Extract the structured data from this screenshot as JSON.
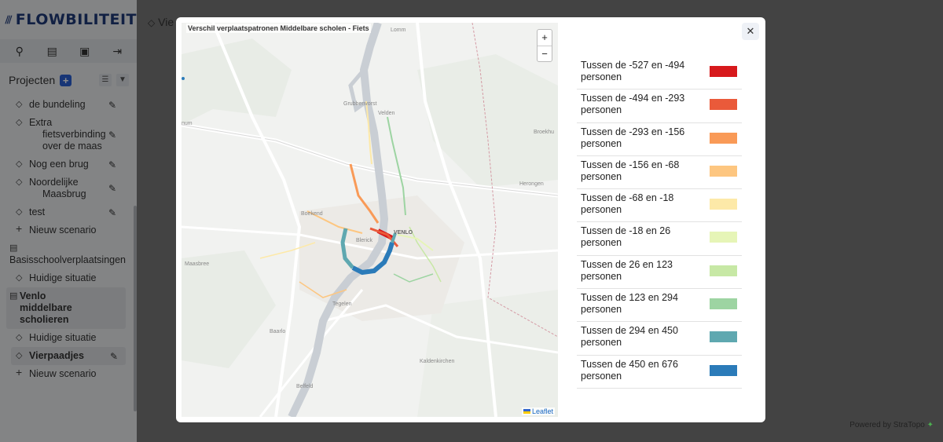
{
  "app": {
    "logo": "FLOWBILITEIT"
  },
  "sidebar": {
    "projects_title": "Projecten",
    "items": [
      {
        "label": "de bundeling",
        "level": 1,
        "edit": true
      },
      {
        "label": "Extra fietsverbinding over de maas",
        "level": 1,
        "edit": true
      },
      {
        "label": "Nog een brug",
        "level": 1,
        "edit": true
      },
      {
        "label": "Noordelijke Maasbrug",
        "level": 1,
        "edit": true
      },
      {
        "label": "test",
        "level": 1,
        "edit": true
      },
      {
        "label": "Nieuw scenario",
        "level": 1,
        "add": true
      },
      {
        "label": "Basisschoolverplaatsingen",
        "level": 0
      },
      {
        "label": "Huidige situatie",
        "level": 1
      },
      {
        "label": "Venlo middelbare scholieren",
        "level": 0
      },
      {
        "label": "Huidige situatie",
        "level": 1
      },
      {
        "label": "Vierpaadjes",
        "level": 1,
        "edit": true
      },
      {
        "label": "Nieuw scenario",
        "level": 1,
        "add": true
      }
    ]
  },
  "main": {
    "header": "Vie",
    "powered": "Powered by StraTopo"
  },
  "modal": {
    "map_title": "Verschil verplaatspatronen Middelbare scholen - Fiets",
    "zoom_in": "+",
    "zoom_out": "−",
    "attribution": "Leaflet",
    "close": "✕",
    "places": [
      "Lomm",
      "Grubbenvorst",
      "Velden",
      "Broekhu",
      "Herongen",
      "Boekend",
      "VENLO",
      "Blerick",
      "Maasbree",
      "Tegelen",
      "Baarlo",
      "Kaldenkirchen",
      "Belfeld",
      "num"
    ],
    "legend": [
      {
        "label": "Tussen de -527 en -494 personen",
        "color": "#d7191c"
      },
      {
        "label": "Tussen de -494 en -293 personen",
        "color": "#ea5a3a"
      },
      {
        "label": "Tussen de -293 en -156 personen",
        "color": "#f99a57"
      },
      {
        "label": "Tussen de -156 en -68 personen",
        "color": "#fdc680"
      },
      {
        "label": "Tussen de -68 en -18 personen",
        "color": "#fde9a8"
      },
      {
        "label": "Tussen de -18 en 26 personen",
        "color": "#e6f5b7"
      },
      {
        "label": "Tussen de 26 en 123 personen",
        "color": "#c7e8a5"
      },
      {
        "label": "Tussen de 123 en 294 personen",
        "color": "#9dd4a2"
      },
      {
        "label": "Tussen de 294 en 450 personen",
        "color": "#5fa8b0"
      },
      {
        "label": "Tussen de 450 en 676 personen",
        "color": "#2b7bb9"
      }
    ]
  }
}
